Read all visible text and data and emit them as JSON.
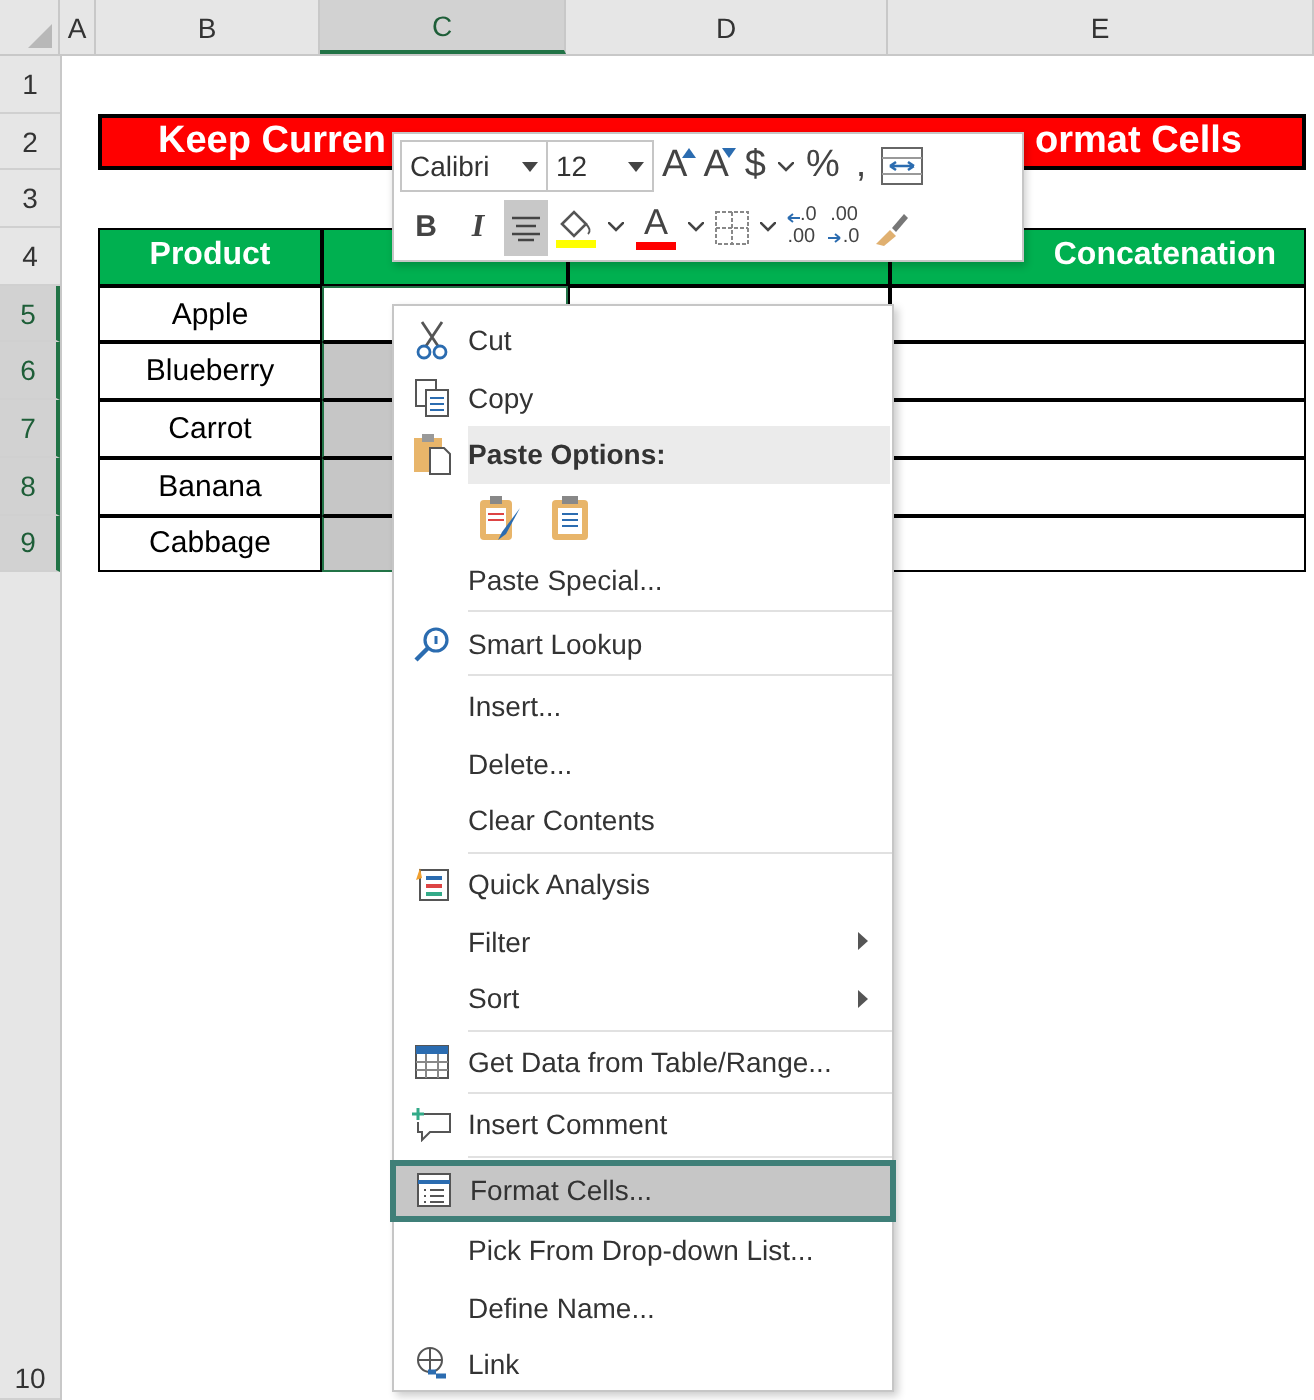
{
  "columns": [
    {
      "label": "A",
      "selected": false
    },
    {
      "label": "B",
      "selected": false
    },
    {
      "label": "C",
      "selected": true
    },
    {
      "label": "D",
      "selected": false
    },
    {
      "label": "E",
      "selected": false
    }
  ],
  "rows": [
    {
      "label": "1",
      "selected": false
    },
    {
      "label": "2",
      "selected": false
    },
    {
      "label": "3",
      "selected": false
    },
    {
      "label": "4",
      "selected": false
    },
    {
      "label": "5",
      "selected": true
    },
    {
      "label": "6",
      "selected": true
    },
    {
      "label": "7",
      "selected": true
    },
    {
      "label": "8",
      "selected": true
    },
    {
      "label": "9",
      "selected": true
    },
    {
      "label": "10",
      "selected": false
    }
  ],
  "title": {
    "left": "Keep Curren",
    "right": "ormat Cells"
  },
  "table": {
    "header_b": "Product",
    "header_e": "Concatenation",
    "products": [
      {
        "name": "Apple",
        "selected": false
      },
      {
        "name": "Blueberry",
        "selected": true
      },
      {
        "name": "Carrot",
        "selected": true
      },
      {
        "name": "Banana",
        "selected": true
      },
      {
        "name": "Cabbage",
        "selected": true
      }
    ]
  },
  "mini_toolbar": {
    "font": "Calibri",
    "size": "12",
    "row1": [
      {
        "kind": "grow",
        "label": "A"
      },
      {
        "kind": "shrink",
        "label": "A"
      },
      {
        "kind": "text",
        "label": "$"
      },
      {
        "kind": "caret"
      },
      {
        "kind": "text",
        "label": "%"
      },
      {
        "kind": "text",
        "label": ","
      },
      {
        "kind": "wrap"
      }
    ],
    "row2": [
      {
        "kind": "bold",
        "label": "B",
        "pressed": false
      },
      {
        "kind": "italic",
        "label": "I",
        "pressed": false
      },
      {
        "kind": "align",
        "pressed": true
      },
      {
        "kind": "fill",
        "color": "#ffff00",
        "pressed": false
      },
      {
        "kind": "caret",
        "pressed": false
      },
      {
        "kind": "fontcolor",
        "label": "A",
        "color": "#ff0000",
        "pressed": false
      },
      {
        "kind": "caret",
        "pressed": false
      },
      {
        "kind": "borders",
        "pressed": false
      },
      {
        "kind": "caret",
        "pressed": false
      },
      {
        "kind": "incdec",
        "lines": [
          ".0",
          ".00"
        ],
        "pressed": false
      },
      {
        "kind": "decdec",
        "lines": [
          ".00",
          ".0"
        ],
        "pressed": false
      },
      {
        "kind": "painter",
        "pressed": false
      }
    ]
  },
  "context_menu": {
    "items": [
      {
        "kind": "command",
        "label": "Cut",
        "submenu": false,
        "selected": false
      },
      {
        "kind": "command",
        "label": "Copy",
        "submenu": false,
        "selected": false
      },
      {
        "kind": "heading",
        "label": "Paste Options:"
      },
      {
        "kind": "paste-buttons"
      },
      {
        "kind": "command",
        "label": "Paste Special...",
        "submenu": false,
        "selected": false
      },
      {
        "kind": "separator"
      },
      {
        "kind": "command",
        "label": "Smart Lookup",
        "submenu": false,
        "selected": false
      },
      {
        "kind": "separator"
      },
      {
        "kind": "command",
        "label": "Insert...",
        "submenu": false,
        "selected": false
      },
      {
        "kind": "command",
        "label": "Delete...",
        "submenu": false,
        "selected": false
      },
      {
        "kind": "command",
        "label": "Clear Contents",
        "submenu": false,
        "selected": false
      },
      {
        "kind": "separator"
      },
      {
        "kind": "command",
        "label": "Quick Analysis",
        "submenu": false,
        "selected": false
      },
      {
        "kind": "command",
        "label": "Filter",
        "submenu": true,
        "selected": false
      },
      {
        "kind": "command",
        "label": "Sort",
        "submenu": true,
        "selected": false
      },
      {
        "kind": "separator"
      },
      {
        "kind": "command",
        "label": "Get Data from Table/Range...",
        "submenu": false,
        "selected": false
      },
      {
        "kind": "separator"
      },
      {
        "kind": "command",
        "label": "Insert Comment",
        "submenu": false,
        "selected": false
      },
      {
        "kind": "separator"
      },
      {
        "kind": "command",
        "label": "Format Cells...",
        "submenu": false,
        "selected": true
      },
      {
        "kind": "command",
        "label": "Pick From Drop-down List...",
        "submenu": false,
        "selected": false
      },
      {
        "kind": "command",
        "label": "Define Name...",
        "submenu": false,
        "selected": false
      },
      {
        "kind": "command",
        "label": "Link",
        "submenu": false,
        "selected": false
      }
    ]
  }
}
